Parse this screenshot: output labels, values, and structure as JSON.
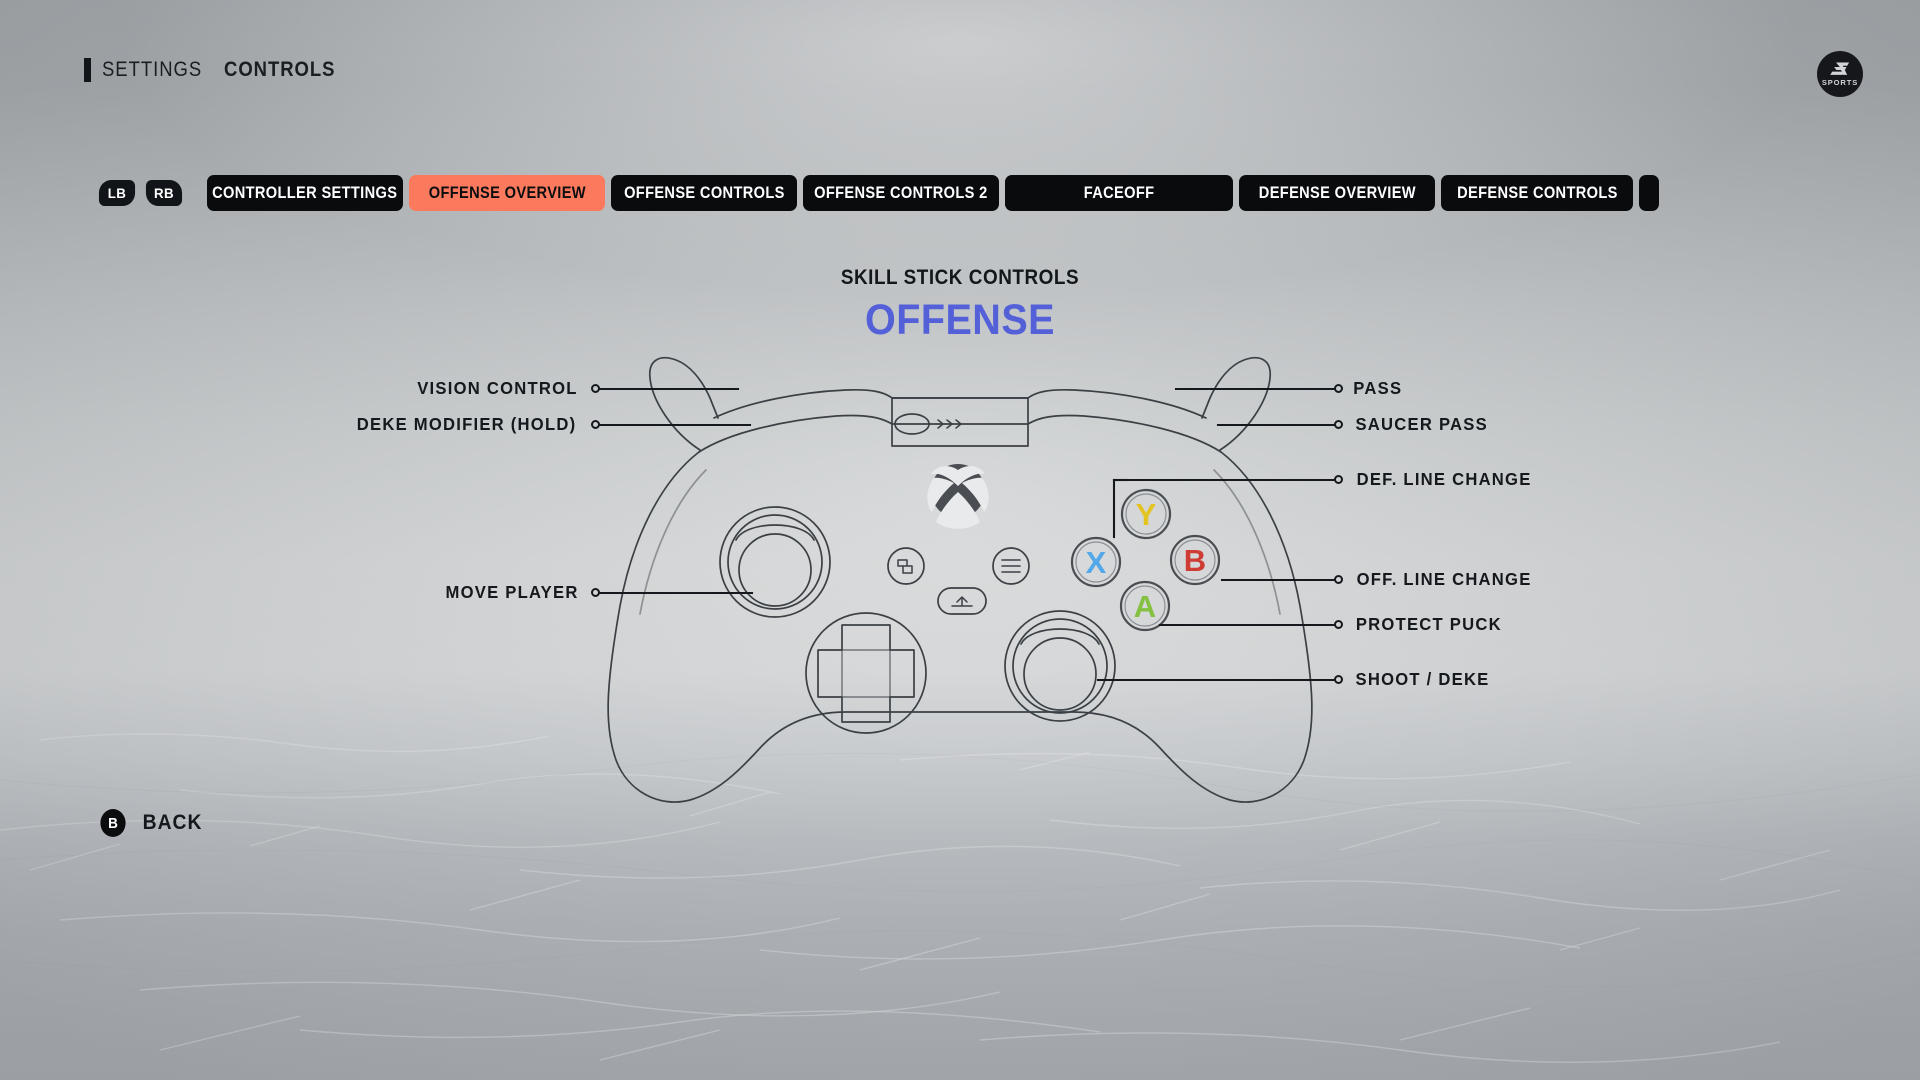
{
  "header": {
    "breadcrumb_light": "SETTINGS",
    "breadcrumb_bold": "CONTROLS"
  },
  "brand": {
    "name": "EA",
    "sub": "SPORTS"
  },
  "tabbar": {
    "bumper_left": "LB",
    "bumper_right": "RB",
    "active_index": 1,
    "tabs": [
      {
        "label": "CONTROLLER SETTINGS"
      },
      {
        "label": "OFFENSE OVERVIEW"
      },
      {
        "label": "OFFENSE CONTROLS"
      },
      {
        "label": "OFFENSE CONTROLS 2"
      },
      {
        "label": "FACEOFF"
      },
      {
        "label": "DEFENSE OVERVIEW"
      },
      {
        "label": "DEFENSE CONTROLS"
      },
      {
        "label": ""
      }
    ]
  },
  "title": {
    "kicker": "SKILL STICK CONTROLS",
    "main": "OFFENSE",
    "main_color": "#5360d8"
  },
  "callouts": {
    "left": [
      {
        "label": "VISION CONTROL"
      },
      {
        "label": "DEKE MODIFIER (HOLD)"
      },
      {
        "label": "MOVE PLAYER"
      }
    ],
    "right": [
      {
        "label": "PASS"
      },
      {
        "label": "SAUCER PASS"
      },
      {
        "label": "DEF. LINE CHANGE"
      },
      {
        "label": "OFF. LINE CHANGE"
      },
      {
        "label": "PROTECT PUCK"
      },
      {
        "label": "SHOOT / DEKE"
      }
    ]
  },
  "controller": {
    "face_buttons": [
      {
        "glyph": "Y",
        "color": "#e4c423"
      },
      {
        "glyph": "X",
        "color": "#52a8e8"
      },
      {
        "glyph": "B",
        "color": "#cf3c33"
      },
      {
        "glyph": "A",
        "color": "#84c141"
      }
    ]
  },
  "footer": {
    "back_glyph": "B",
    "back_label": "BACK"
  }
}
